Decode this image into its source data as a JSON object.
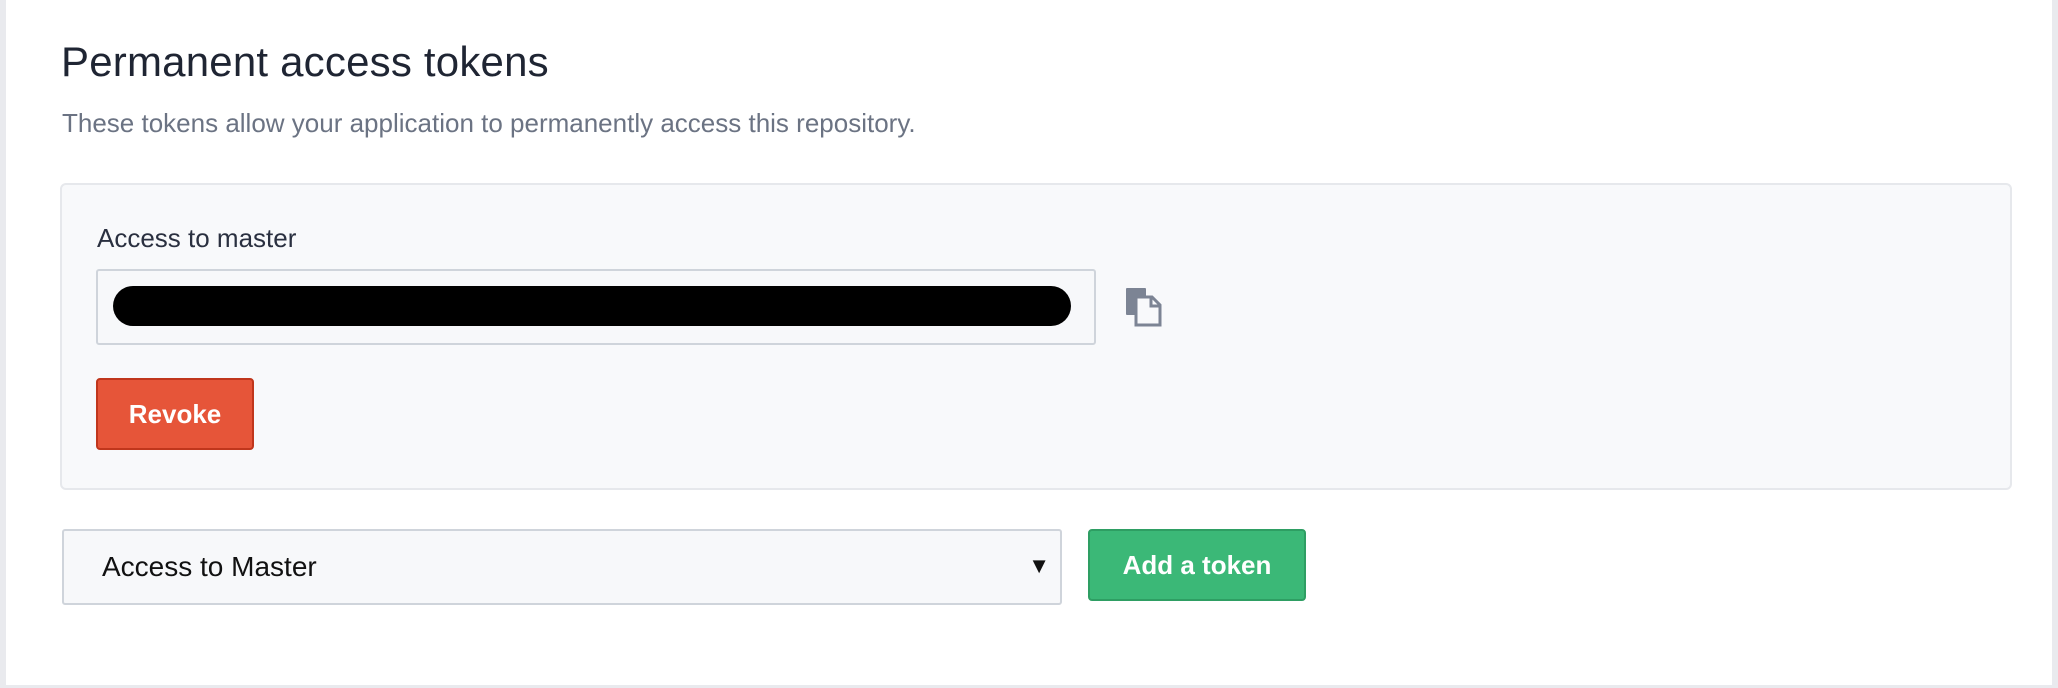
{
  "page": {
    "title": "Permanent access tokens",
    "subtitle": "These tokens allow your application to permanently access this repository."
  },
  "token_card": {
    "label": "Access to master",
    "token_value_redacted": true,
    "copy_icon": "copy-icon",
    "revoke_label": "Revoke"
  },
  "new_token": {
    "selected_option": "Access to Master",
    "add_label": "Add a token"
  },
  "colors": {
    "revoke": "#e65539",
    "add": "#3bb877",
    "title": "#1f2533",
    "subtitle": "#6b7383"
  }
}
